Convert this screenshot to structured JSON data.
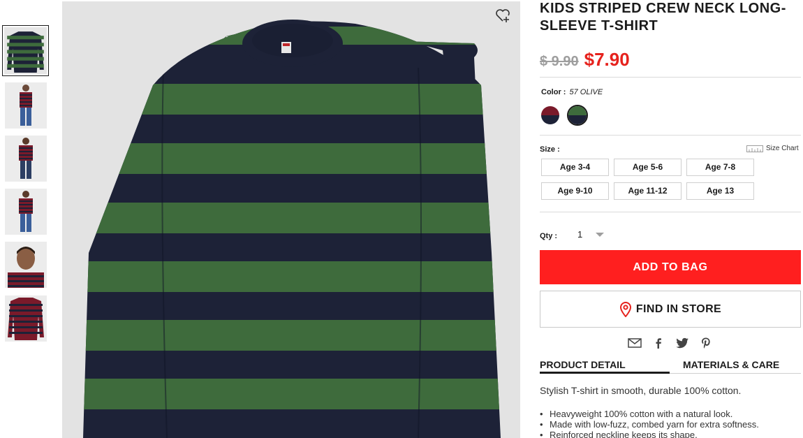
{
  "product": {
    "title": "KIDS STRIPED CREW NECK LONG-SLEEVE T-SHIRT",
    "old_price": "$ 9.90",
    "price": "$7.90",
    "color_label": "Color :",
    "color_value": "57 OLIVE",
    "colors": [
      {
        "name": "wine-navy",
        "top": "#7a1a2a",
        "bottom": "#1d2237"
      },
      {
        "name": "olive",
        "top": "#3e6b3c",
        "bottom": "#1d2237",
        "selected": true
      }
    ],
    "size_label": "Size :",
    "size_chart": "Size Chart",
    "sizes": [
      "Age 3-4",
      "Age 5-6",
      "Age 7-8",
      "Age 9-10",
      "Age 11-12",
      "Age 13"
    ],
    "qty_label": "Qty :",
    "qty_value": "1",
    "add_to_bag": "ADD TO BAG",
    "find_in_store": "FIND IN STORE"
  },
  "share_icons": [
    "mail-icon",
    "facebook-icon",
    "twitter-icon",
    "pinterest-icon"
  ],
  "tabs": [
    {
      "label": "PRODUCT DETAIL",
      "active": true
    },
    {
      "label": "MATERIALS & CARE",
      "active": false
    }
  ],
  "detail": {
    "description": "Stylish T-shirt in smooth, durable 100% cotton.",
    "bullets": [
      "Heavyweight 100% cotton with a natural look.",
      "Made with low-fuzz, combed yarn for extra softness.",
      "Reinforced neckline keeps its shape."
    ]
  },
  "thumbnails": [
    {
      "name": "thumb-olive-flat",
      "stripe_a": "#3e6b3c",
      "stripe_b": "#1d2237",
      "type": "flat",
      "selected": true
    },
    {
      "name": "thumb-model-front",
      "stripe_a": "#7a1a2a",
      "stripe_b": "#1d2237",
      "type": "model"
    },
    {
      "name": "thumb-model-front-2",
      "stripe_a": "#7a1a2a",
      "stripe_b": "#1d2237",
      "type": "model"
    },
    {
      "name": "thumb-model-3",
      "stripe_a": "#7a1a2a",
      "stripe_b": "#1d2237",
      "type": "model"
    },
    {
      "name": "thumb-model-closeup",
      "stripe_a": "#7a1a2a",
      "stripe_b": "#1d2237",
      "type": "closeup"
    },
    {
      "name": "thumb-wine-flat",
      "stripe_a": "#7a1a2a",
      "stripe_b": "#1d2237",
      "type": "flat"
    }
  ],
  "colors": {
    "accent_red": "#ff1f1f",
    "price_red": "#e6221d",
    "shirt_green": "#3e6b3c",
    "shirt_navy": "#1d2237"
  }
}
